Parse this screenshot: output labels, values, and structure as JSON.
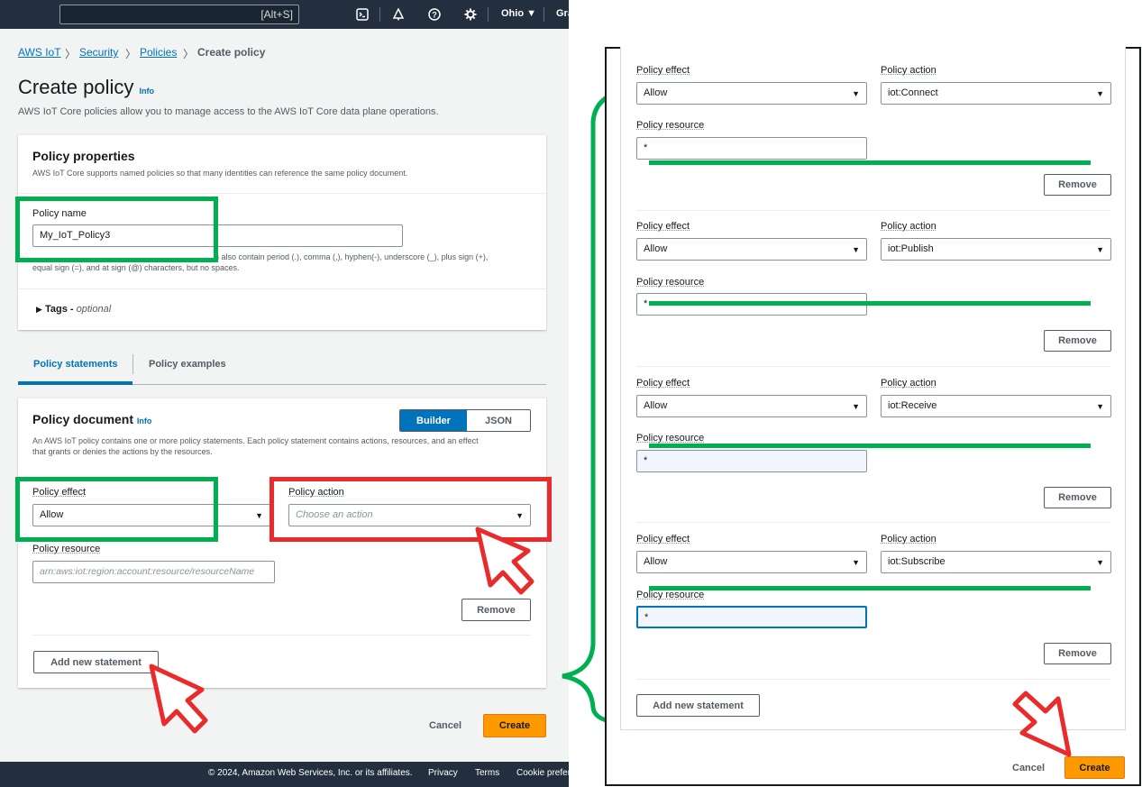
{
  "topbar": {
    "search_shortcut": "[Alt+S]",
    "region": "Ohio",
    "account_truncated": "Gra"
  },
  "breadcrumb": {
    "items": [
      "AWS IoT",
      "Security",
      "Policies"
    ],
    "current": "Create policy"
  },
  "page": {
    "title": "Create policy",
    "info": "Info",
    "description": "AWS IoT Core policies allow you to manage access to the AWS IoT Core data plane operations."
  },
  "properties": {
    "title": "Policy properties",
    "description": "AWS IoT Core supports named policies so that many identities can reference the same policy document.",
    "name_label": "Policy name",
    "name_value": "My_IoT_Policy3",
    "hint_line1": "n also contain period (.), comma (,), hyphen(-), underscore (_), plus sign (+),",
    "hint_line2": "equal sign (=), and at sign (@) characters, but no spaces.",
    "tags_label": "Tags -",
    "tags_optional": "optional"
  },
  "tabs": {
    "statements": "Policy statements",
    "examples": "Policy examples"
  },
  "document": {
    "title": "Policy document",
    "info": "Info",
    "builder": "Builder",
    "json": "JSON",
    "desc_line1": "An AWS IoT policy contains one or more policy statements. Each policy statement contains actions, resources, and an effect",
    "desc_line2": "that grants or denies the actions by the resources.",
    "effect_label": "Policy effect",
    "effect_value": "Allow",
    "action_label": "Policy action",
    "action_placeholder": "Choose an action",
    "resource_label": "Policy resource",
    "resource_placeholder": "arn:aws:iot:region:account:resource/resourceName",
    "remove": "Remove",
    "add_statement": "Add new statement",
    "cancel": "Cancel",
    "create": "Create"
  },
  "footer": {
    "copyright": "© 2024, Amazon Web Services, Inc. or its affiliates.",
    "privacy": "Privacy",
    "terms": "Terms",
    "cookie": "Cookie prefer"
  },
  "right_panel": {
    "effect_label": "Policy effect",
    "action_label": "Policy action",
    "resource_label": "Policy resource",
    "remove": "Remove",
    "statements": [
      {
        "effect": "Allow",
        "action": "iot:Connect",
        "resource": "*"
      },
      {
        "effect": "Allow",
        "action": "iot:Publish",
        "resource": "*"
      },
      {
        "effect": "Allow",
        "action": "iot:Receive",
        "resource": "*"
      },
      {
        "effect": "Allow",
        "action": "iot:Subscribe",
        "resource": "*"
      }
    ],
    "add_statement": "Add new statement",
    "cancel": "Cancel",
    "create": "Create"
  },
  "colors": {
    "highlight_green": "#00b050",
    "highlight_red": "#ea2b2b",
    "aws_orange": "#ff9900",
    "aws_navy": "#232f3e",
    "link_blue": "#0073bb"
  }
}
